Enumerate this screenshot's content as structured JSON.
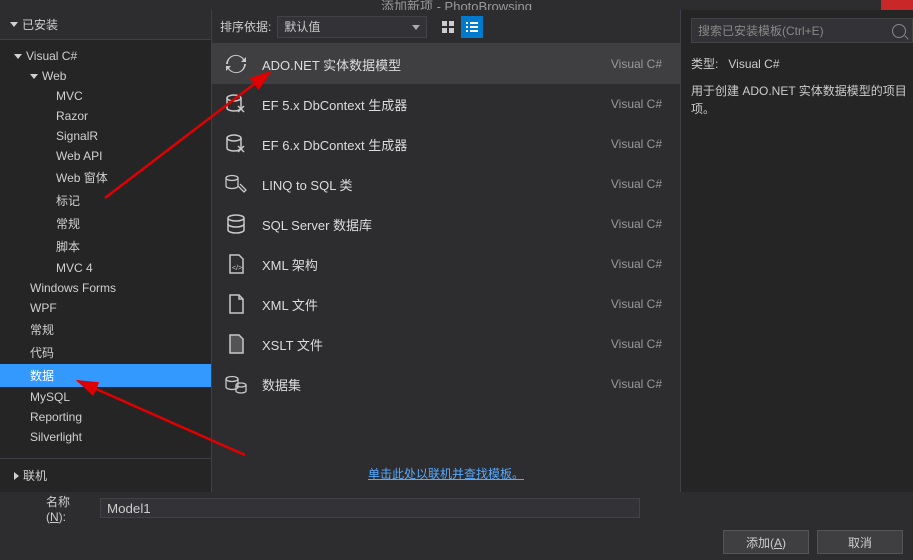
{
  "window": {
    "title": "添加新项 - PhotoBrowsing"
  },
  "leftPanel": {
    "installed": "已安装",
    "online": "联机",
    "tree": {
      "root": "Visual C#",
      "web": "Web",
      "webItems": [
        "MVC",
        "Razor",
        "SignalR",
        "Web API",
        "Web 窗体",
        "标记",
        "常规",
        "脚本",
        "MVC 4"
      ],
      "rootItems": [
        "Windows Forms",
        "WPF",
        "常规",
        "代码",
        "数据",
        "MySQL",
        "Reporting",
        "Silverlight"
      ],
      "selected": "数据"
    }
  },
  "toolbar": {
    "sortLabel": "排序依据:",
    "sortValue": "默认值"
  },
  "templates": [
    {
      "name": "ADO.NET 实体数据模型",
      "lang": "Visual C#",
      "icon": "refresh-arrows"
    },
    {
      "name": "EF 5.x DbContext 生成器",
      "lang": "Visual C#",
      "icon": "db-gen"
    },
    {
      "name": "EF 6.x DbContext 生成器",
      "lang": "Visual C#",
      "icon": "db-gen"
    },
    {
      "name": "LINQ to SQL 类",
      "lang": "Visual C#",
      "icon": "linq"
    },
    {
      "name": "SQL Server 数据库",
      "lang": "Visual C#",
      "icon": "db"
    },
    {
      "name": "XML 架构",
      "lang": "Visual C#",
      "icon": "doc-sm"
    },
    {
      "name": "XML 文件",
      "lang": "Visual C#",
      "icon": "doc"
    },
    {
      "name": "XSLT 文件",
      "lang": "Visual C#",
      "icon": "doc-dk"
    },
    {
      "name": "数据集",
      "lang": "Visual C#",
      "icon": "dataset"
    }
  ],
  "selectedTemplateIndex": 0,
  "onlineLink": "单击此处以联机并查找模板。",
  "rightPanel": {
    "searchPlaceholder": "搜索已安装模板(Ctrl+E)",
    "typeLabel": "类型:",
    "typeValue": "Visual C#",
    "description": "用于创建 ADO.NET 实体数据模型的项目项。"
  },
  "footer": {
    "nameLabel": "名称(N):",
    "nameAccess": "N",
    "nameValue": "Model1",
    "addLabel": "添加(A)",
    "addAccess": "A",
    "cancelLabel": "取消"
  }
}
